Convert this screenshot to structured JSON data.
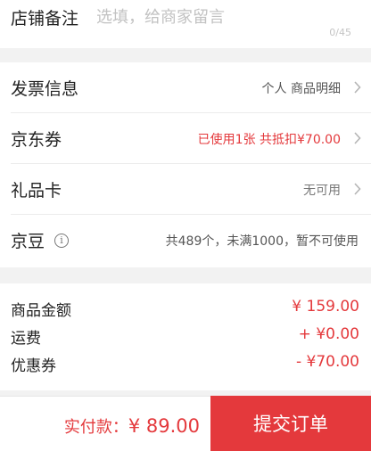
{
  "store_note": {
    "label": "店铺备注",
    "placeholder": "选填，给商家留言",
    "value": "",
    "counter": "0/45"
  },
  "options": {
    "invoice": {
      "label": "发票信息",
      "value": "个人 商品明细"
    },
    "coupon": {
      "label": "京东券",
      "value": "已使用1张 共抵扣¥70.00"
    },
    "gift_card": {
      "label": "礼品卡",
      "value": "无可用"
    },
    "jd_beans": {
      "label": "京豆",
      "info_icon": "i",
      "value": "共489个，未满1000，暂不可使用"
    }
  },
  "summary": {
    "goods_amount": {
      "label": "商品金额",
      "value": "¥ 159.00"
    },
    "shipping": {
      "label": "运费",
      "value": "+ ¥0.00"
    },
    "discount": {
      "label": "优惠券",
      "value": "- ¥70.00"
    }
  },
  "footer": {
    "pay_label": "实付款：",
    "pay_amount": "¥ 89.00",
    "submit_label": "提交订单"
  },
  "colors": {
    "accent": "#e4393c",
    "background": "#f2f2f2"
  }
}
